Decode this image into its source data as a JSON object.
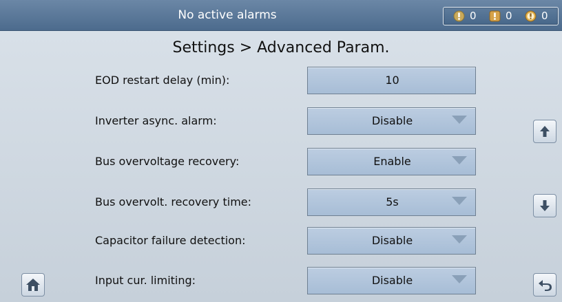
{
  "status_bar": {
    "alarm_message": "No active alarms",
    "counters": [
      {
        "icon": "minor-alarm-icon",
        "count": "0"
      },
      {
        "icon": "major-alarm-icon",
        "count": "0"
      },
      {
        "icon": "critical-alarm-icon",
        "count": "0"
      }
    ]
  },
  "page": {
    "title": "Settings > Advanced Param."
  },
  "settings": [
    {
      "label": "EOD restart delay (min):",
      "value": "10",
      "type": "input"
    },
    {
      "label": "Inverter async. alarm:",
      "value": "Disable",
      "type": "select"
    },
    {
      "label": "Bus overvoltage recovery:",
      "value": "Enable",
      "type": "select"
    },
    {
      "label": "Bus overvolt. recovery time:",
      "value": "5s",
      "type": "select"
    },
    {
      "label": "Capacitor failure detection:",
      "value": "Disable",
      "type": "select"
    },
    {
      "label": "Input cur. limiting:",
      "value": "Disable",
      "type": "select"
    }
  ],
  "nav": {
    "scroll_up_icon": "arrow-up-icon",
    "scroll_down_icon": "arrow-down-icon",
    "home_icon": "home-icon",
    "back_icon": "back-arrow-icon"
  },
  "colors": {
    "header_bg": "#4c6b8d",
    "field_bg": "#a7bdd6",
    "page_bg": "#c9d3dd"
  }
}
